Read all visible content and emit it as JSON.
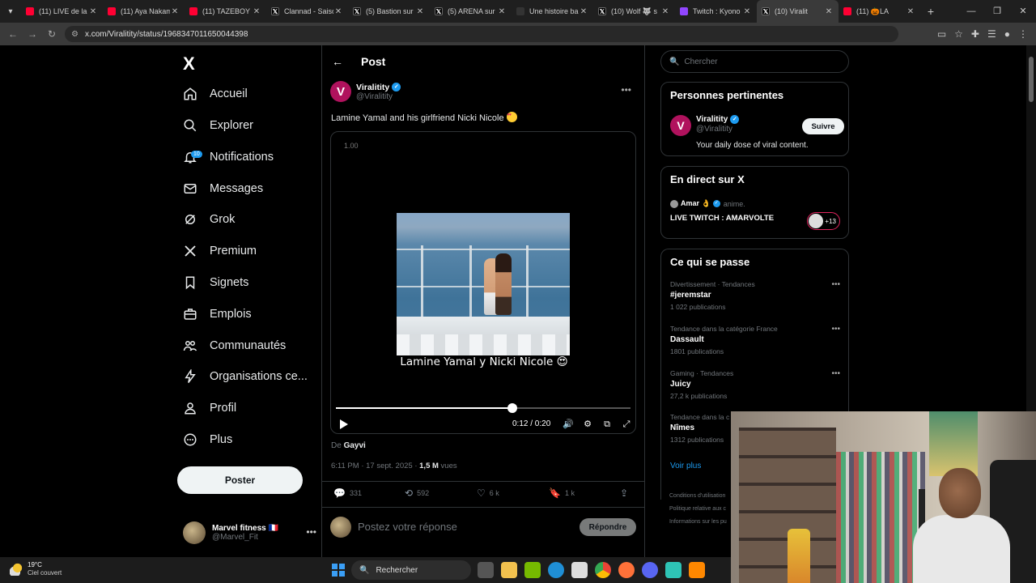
{
  "browser": {
    "tabs": [
      {
        "title": "(11) LIVE de la",
        "fav": "yt"
      },
      {
        "title": "(11) Aya Nakam",
        "fav": "yt"
      },
      {
        "title": "(11) TAZEBOY -",
        "fav": "yt"
      },
      {
        "title": "Clannad - Saiso",
        "fav": "x"
      },
      {
        "title": "(5) Bastion sur",
        "fav": "x"
      },
      {
        "title": "(5) ARENA sur",
        "fav": "x"
      },
      {
        "title": "Une histoire ba",
        "fav": "sc"
      },
      {
        "title": "(10) Wolf 🐺 s",
        "fav": "x"
      },
      {
        "title": "Twitch : Kyono",
        "fav": "tw"
      },
      {
        "title": "(10) Viralit",
        "fav": "x",
        "active": true
      },
      {
        "title": "(11) 🎃LA",
        "fav": "yt"
      }
    ],
    "url": "x.com/Viralitity/status/1968347011650044398"
  },
  "nav": {
    "logo": "X",
    "items": [
      {
        "label": "Accueil",
        "icon": "home-icon"
      },
      {
        "label": "Explorer",
        "icon": "search-icon"
      },
      {
        "label": "Notifications",
        "icon": "bell-icon",
        "badge": "10"
      },
      {
        "label": "Messages",
        "icon": "mail-icon"
      },
      {
        "label": "Grok",
        "icon": "grok-icon"
      },
      {
        "label": "Premium",
        "icon": "x-premium-icon"
      },
      {
        "label": "Signets",
        "icon": "bookmark-icon"
      },
      {
        "label": "Emplois",
        "icon": "briefcase-icon"
      },
      {
        "label": "Communautés",
        "icon": "people-icon"
      },
      {
        "label": "Organisations ce...",
        "icon": "lightning-icon"
      },
      {
        "label": "Profil",
        "icon": "person-icon"
      },
      {
        "label": "Plus",
        "icon": "more-circle-icon"
      }
    ],
    "post_button": "Poster",
    "account": {
      "name": "Marvel fitness 🇫🇷",
      "handle": "@Marvel_Fit"
    }
  },
  "post": {
    "header": "Post",
    "author": {
      "name": "Viralitity",
      "handle": "@Viralitity",
      "initial": "V"
    },
    "text": "Lamine Yamal and his girlfriend Nicki Nicole",
    "video": {
      "corner_label": "1.00",
      "caption": "Lamine Yamal y Nicki Nicole 😍",
      "time": "0:12 / 0:20",
      "progress": 0.6
    },
    "from_label": "De",
    "from_user": "Gayvi",
    "timestamp": "6:11 PM · 17 sept. 2025 · ",
    "views": "1,5 M",
    "views_label": " vues",
    "stats": {
      "replies": "331",
      "reposts": "592",
      "likes": "6 k",
      "bookmarks": "1 k"
    },
    "reply_placeholder": "Postez votre réponse",
    "reply_button": "Répondre"
  },
  "sidebar": {
    "search_placeholder": "Chercher",
    "relevant": {
      "title": "Personnes pertinentes",
      "name": "Viralitity",
      "handle": "@Viralitity",
      "bio": "Your daily dose of viral content.",
      "follow": "Suivre"
    },
    "live": {
      "title": "En direct sur X",
      "host": "Amar 👌",
      "category": "anime.",
      "stream_title": "LIVE TWITCH : AMARVOLTE",
      "listeners": "+13"
    },
    "trends": {
      "title": "Ce qui se passe",
      "items": [
        {
          "category": "Divertissement · Tendances",
          "name": "#jeremstar",
          "count": "1 022 publications"
        },
        {
          "category": "Tendance dans la catégorie France",
          "name": "Dassault",
          "count": "1801 publications"
        },
        {
          "category": "Gaming · Tendances",
          "name": "Juicy",
          "count": "27,2 k publications"
        },
        {
          "category": "Tendance dans la c",
          "name": "Nîmes",
          "count": "1312 publications"
        }
      ],
      "see_more": "Voir plus"
    },
    "footer": [
      "Conditions d'utilisation",
      "Politique relative aux c",
      "Informations sur les pu"
    ]
  },
  "taskbar": {
    "temp": "19°C",
    "weather": "Ciel couvert",
    "search": "Rechercher"
  }
}
